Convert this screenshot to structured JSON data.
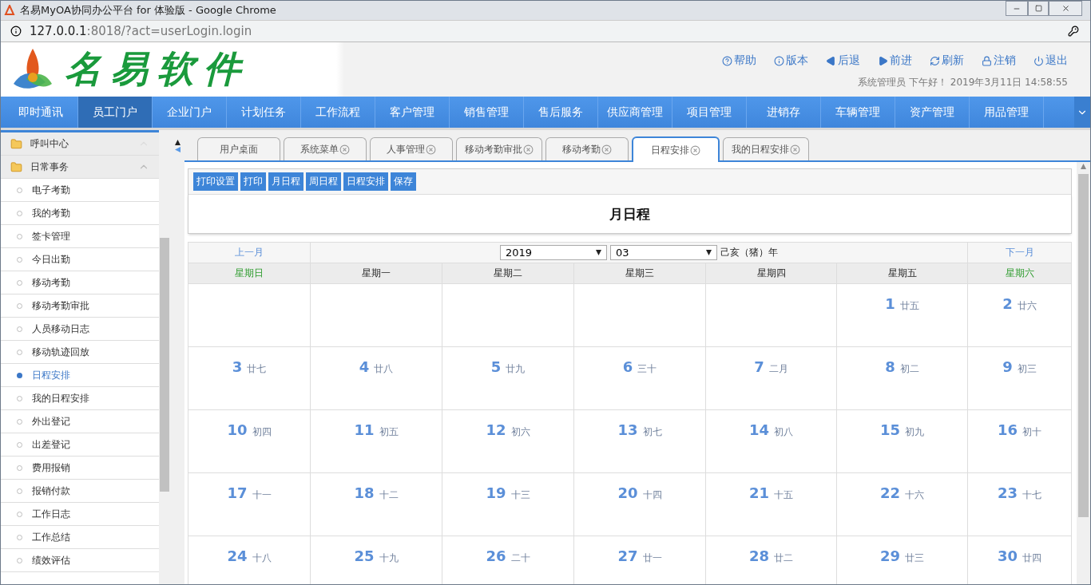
{
  "window": {
    "title": "名易MyOA协同办公平台 for 体验版 - Google Chrome",
    "address_host": "127.0.0.1",
    "address_rest": ":8018/?act=userLogin.login"
  },
  "header": {
    "logo_text": "名易软件",
    "actions": [
      {
        "kind": "help",
        "label": "帮助"
      },
      {
        "kind": "info",
        "label": "版本"
      },
      {
        "kind": "back",
        "label": "后退"
      },
      {
        "kind": "forward",
        "label": "前进"
      },
      {
        "kind": "refresh",
        "label": "刷新"
      },
      {
        "kind": "lock",
        "label": "注销"
      },
      {
        "kind": "power",
        "label": "退出"
      }
    ],
    "greeting": "系统管理员 下午好！ 2019年3月11日 14:58:55"
  },
  "nav": [
    {
      "label": "即时通讯",
      "selected": false
    },
    {
      "label": "员工门户",
      "selected": true
    },
    {
      "label": "企业门户",
      "selected": false
    },
    {
      "label": "计划任务",
      "selected": false
    },
    {
      "label": "工作流程",
      "selected": false
    },
    {
      "label": "客户管理",
      "selected": false
    },
    {
      "label": "销售管理",
      "selected": false
    },
    {
      "label": "售后服务",
      "selected": false
    },
    {
      "label": "供应商管理",
      "selected": false
    },
    {
      "label": "项目管理",
      "selected": false
    },
    {
      "label": "进销存",
      "selected": false
    },
    {
      "label": "车辆管理",
      "selected": false
    },
    {
      "label": "资产管理",
      "selected": false
    },
    {
      "label": "用品管理",
      "selected": false
    }
  ],
  "sidebar": {
    "groups": [
      {
        "label": "呼叫中心",
        "expanded": false
      },
      {
        "label": "日常事务",
        "expanded": true,
        "children": [
          {
            "label": "电子考勤",
            "selected": false
          },
          {
            "label": "我的考勤",
            "selected": false
          },
          {
            "label": "签卡管理",
            "selected": false
          },
          {
            "label": "今日出勤",
            "selected": false
          },
          {
            "label": "移动考勤",
            "selected": false
          },
          {
            "label": "移动考勤审批",
            "selected": false
          },
          {
            "label": "人员移动日志",
            "selected": false
          },
          {
            "label": "移动轨迹回放",
            "selected": false
          },
          {
            "label": "日程安排",
            "selected": true
          },
          {
            "label": "我的日程安排",
            "selected": false
          },
          {
            "label": "外出登记",
            "selected": false
          },
          {
            "label": "出差登记",
            "selected": false
          },
          {
            "label": "费用报销",
            "selected": false
          },
          {
            "label": "报销付款",
            "selected": false
          },
          {
            "label": "工作日志",
            "selected": false
          },
          {
            "label": "工作总结",
            "selected": false
          },
          {
            "label": "绩效评估",
            "selected": false
          }
        ]
      }
    ]
  },
  "tabs": [
    {
      "label": "用户桌面",
      "closable": false,
      "selected": false
    },
    {
      "label": "系统菜单",
      "closable": true,
      "selected": false
    },
    {
      "label": "人事管理",
      "closable": true,
      "selected": false
    },
    {
      "label": "移动考勤审批",
      "closable": true,
      "selected": false
    },
    {
      "label": "移动考勤",
      "closable": true,
      "selected": false
    },
    {
      "label": "日程安排",
      "closable": true,
      "selected": true
    },
    {
      "label": "我的日程安排",
      "closable": true,
      "selected": false
    }
  ],
  "toolbar": [
    "打印设置",
    "打印",
    "月日程",
    "周日程",
    "日程安排",
    "保存"
  ],
  "page_title": "月日程",
  "calendar": {
    "prev": "上一月",
    "next": "下一月",
    "year": "2019",
    "month": "03",
    "ganzhi": "己亥（猪）年",
    "weekdays": [
      {
        "label": "星期日",
        "weekend": true
      },
      {
        "label": "星期一",
        "weekend": false
      },
      {
        "label": "星期二",
        "weekend": false
      },
      {
        "label": "星期三",
        "weekend": false
      },
      {
        "label": "星期四",
        "weekend": false
      },
      {
        "label": "星期五",
        "weekend": false
      },
      {
        "label": "星期六",
        "weekend": true
      }
    ],
    "weeks": [
      [
        {
          "kind": "blank"
        },
        {
          "kind": "blank"
        },
        {
          "kind": "blank"
        },
        {
          "kind": "blank"
        },
        {
          "kind": "blank"
        },
        {
          "kind": "day",
          "day": "1",
          "lunar": "廿五"
        },
        {
          "kind": "day",
          "day": "2",
          "lunar": "廿六"
        }
      ],
      [
        {
          "kind": "day",
          "day": "3",
          "lunar": "廿七"
        },
        {
          "kind": "day",
          "day": "4",
          "lunar": "廿八"
        },
        {
          "kind": "day",
          "day": "5",
          "lunar": "廿九"
        },
        {
          "kind": "day",
          "day": "6",
          "lunar": "三十"
        },
        {
          "kind": "day",
          "day": "7",
          "lunar": "二月"
        },
        {
          "kind": "day",
          "day": "8",
          "lunar": "初二"
        },
        {
          "kind": "day",
          "day": "9",
          "lunar": "初三"
        }
      ],
      [
        {
          "kind": "day",
          "day": "10",
          "lunar": "初四"
        },
        {
          "kind": "day",
          "day": "11",
          "lunar": "初五"
        },
        {
          "kind": "day",
          "day": "12",
          "lunar": "初六"
        },
        {
          "kind": "day",
          "day": "13",
          "lunar": "初七"
        },
        {
          "kind": "day",
          "day": "14",
          "lunar": "初八"
        },
        {
          "kind": "day",
          "day": "15",
          "lunar": "初九"
        },
        {
          "kind": "day",
          "day": "16",
          "lunar": "初十"
        }
      ],
      [
        {
          "kind": "day",
          "day": "17",
          "lunar": "十一"
        },
        {
          "kind": "day",
          "day": "18",
          "lunar": "十二"
        },
        {
          "kind": "day",
          "day": "19",
          "lunar": "十三"
        },
        {
          "kind": "day",
          "day": "20",
          "lunar": "十四"
        },
        {
          "kind": "day",
          "day": "21",
          "lunar": "十五"
        },
        {
          "kind": "day",
          "day": "22",
          "lunar": "十六"
        },
        {
          "kind": "day",
          "day": "23",
          "lunar": "十七"
        }
      ],
      [
        {
          "kind": "day",
          "day": "24",
          "lunar": "十八"
        },
        {
          "kind": "day",
          "day": "25",
          "lunar": "十九"
        },
        {
          "kind": "day",
          "day": "26",
          "lunar": "二十"
        },
        {
          "kind": "day",
          "day": "27",
          "lunar": "廿一"
        },
        {
          "kind": "day",
          "day": "28",
          "lunar": "廿二"
        },
        {
          "kind": "day",
          "day": "29",
          "lunar": "廿三"
        },
        {
          "kind": "day",
          "day": "30",
          "lunar": "廿四"
        }
      ]
    ]
  }
}
